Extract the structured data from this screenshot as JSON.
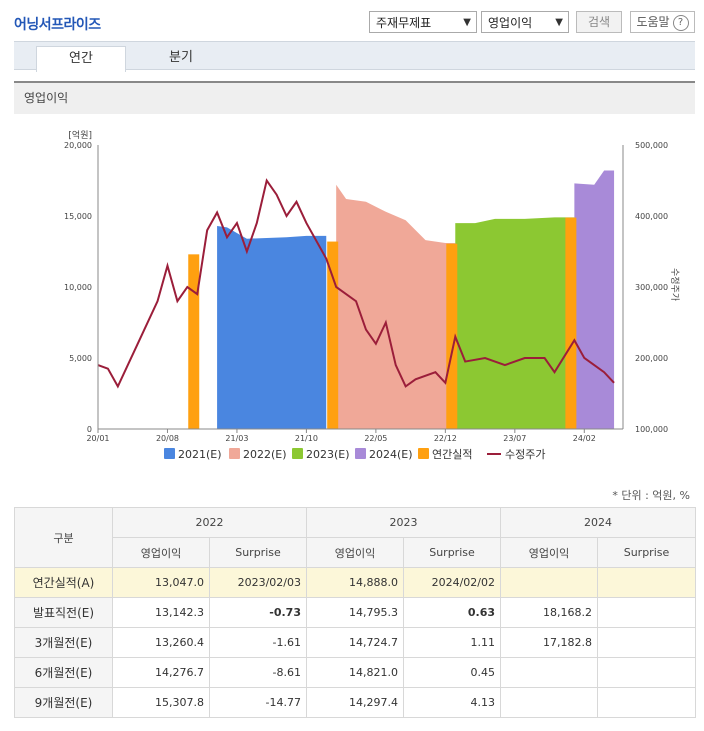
{
  "page": {
    "title": "어닝서프라이즈",
    "select_1": "주재무제표",
    "select_2": "영업이익",
    "search_button": "검색",
    "help_button": "도움말",
    "help_mark": "?",
    "tabs": [
      "연간",
      "분기"
    ],
    "section_title": "영업이익",
    "unit_note": "* 단위 : 억원, %"
  },
  "chart_data": {
    "type": "area",
    "left_axis_unit": "[억원]",
    "right_axis_label": "수정주가",
    "ylim_left": [
      0,
      20000
    ],
    "ylim_right": [
      100000,
      500000
    ],
    "left_ticks": [
      "20,000",
      "15,000",
      "10,000",
      "5,000",
      "0"
    ],
    "right_ticks": [
      "500,000",
      "400,000",
      "300,000",
      "200,000",
      "100,000"
    ],
    "x_ticks": [
      "20/01",
      "20/08",
      "21/03",
      "21/10",
      "22/05",
      "22/12",
      "23/07",
      "24/02"
    ],
    "grid": false,
    "legend_position": "bottom",
    "colors": {
      "2021(E)": "#4a86e0",
      "2022(E)": "#f0a898",
      "2023(E)": "#8cc832",
      "2024(E)": "#a88ad8",
      "연간실적": "#ffa010",
      "수정주가": "#9b1e3a"
    },
    "legend": [
      "2021(E)",
      "2022(E)",
      "2023(E)",
      "2024(E)",
      "연간실적",
      "수정주가"
    ],
    "series": [
      {
        "name": "2021(E)",
        "points": [
          [
            "21/01",
            14300
          ],
          [
            "21/02",
            14200
          ],
          [
            "21/04",
            13400
          ],
          [
            "21/06",
            13450
          ],
          [
            "21/08",
            13500
          ],
          [
            "21/10",
            13600
          ],
          [
            "21/12",
            13600
          ]
        ]
      },
      {
        "name": "2022(E)",
        "points": [
          [
            "22/01",
            17200
          ],
          [
            "22/02",
            16200
          ],
          [
            "22/04",
            16000
          ],
          [
            "22/06",
            15300
          ],
          [
            "22/08",
            14700
          ],
          [
            "22/10",
            13300
          ],
          [
            "22/12",
            13100
          ],
          [
            "23/01",
            13100
          ]
        ]
      },
      {
        "name": "2023(E)",
        "points": [
          [
            "23/01",
            14500
          ],
          [
            "23/03",
            14500
          ],
          [
            "23/05",
            14800
          ],
          [
            "23/08",
            14800
          ],
          [
            "23/11",
            14900
          ],
          [
            "24/01",
            14900
          ]
        ]
      },
      {
        "name": "2024(E)",
        "points": [
          [
            "24/01",
            17300
          ],
          [
            "24/03",
            17200
          ],
          [
            "24/04",
            18200
          ],
          [
            "24/05",
            18200
          ]
        ]
      },
      {
        "name": "연간실적",
        "points": [
          [
            "20/11",
            12300
          ],
          [
            "22/01",
            13200
          ],
          [
            "23/01",
            13047
          ],
          [
            "24/01",
            14888
          ]
        ]
      },
      {
        "name": "수정주가",
        "points": [
          [
            "20/01",
            190000
          ],
          [
            "20/02",
            185000
          ],
          [
            "20/03",
            160000
          ],
          [
            "20/05",
            220000
          ],
          [
            "20/07",
            280000
          ],
          [
            "20/08",
            330000
          ],
          [
            "20/09",
            280000
          ],
          [
            "20/10",
            300000
          ],
          [
            "20/11",
            290000
          ],
          [
            "20/12",
            380000
          ],
          [
            "21/01",
            405000
          ],
          [
            "21/02",
            370000
          ],
          [
            "21/03",
            390000
          ],
          [
            "21/04",
            350000
          ],
          [
            "21/05",
            390000
          ],
          [
            "21/06",
            450000
          ],
          [
            "21/07",
            430000
          ],
          [
            "21/08",
            400000
          ],
          [
            "21/09",
            420000
          ],
          [
            "21/10",
            390000
          ],
          [
            "21/12",
            340000
          ],
          [
            "22/01",
            300000
          ],
          [
            "22/03",
            280000
          ],
          [
            "22/04",
            240000
          ],
          [
            "22/05",
            220000
          ],
          [
            "22/06",
            250000
          ],
          [
            "22/07",
            190000
          ],
          [
            "22/08",
            160000
          ],
          [
            "22/09",
            170000
          ],
          [
            "22/11",
            180000
          ],
          [
            "22/12",
            165000
          ],
          [
            "23/01",
            230000
          ],
          [
            "23/02",
            195000
          ],
          [
            "23/04",
            200000
          ],
          [
            "23/06",
            190000
          ],
          [
            "23/08",
            200000
          ],
          [
            "23/10",
            200000
          ],
          [
            "23/11",
            180000
          ],
          [
            "24/01",
            225000
          ],
          [
            "24/02",
            200000
          ],
          [
            "24/03",
            190000
          ],
          [
            "24/04",
            180000
          ],
          [
            "24/05",
            165000
          ]
        ]
      }
    ]
  },
  "table": {
    "header_col": "구분",
    "years": [
      "2022",
      "2023",
      "2024"
    ],
    "subcols": [
      "영업이익",
      "Surprise"
    ],
    "rows": [
      {
        "label": "연간실적(A)",
        "cells": [
          "13,047.0",
          "2023/02/03",
          "14,888.0",
          "2024/02/02",
          "",
          ""
        ],
        "highlight": true
      },
      {
        "label": "발표직전(E)",
        "cells": [
          "13,142.3",
          "-0.73",
          "14,795.3",
          "0.63",
          "18,168.2",
          ""
        ]
      },
      {
        "label": "3개월전(E)",
        "cells": [
          "13,260.4",
          "-1.61",
          "14,724.7",
          "1.11",
          "17,182.8",
          ""
        ]
      },
      {
        "label": "6개월전(E)",
        "cells": [
          "14,276.7",
          "-8.61",
          "14,821.0",
          "0.45",
          "",
          ""
        ]
      },
      {
        "label": "9개월전(E)",
        "cells": [
          "15,307.8",
          "-14.77",
          "14,297.4",
          "4.13",
          "",
          ""
        ]
      }
    ]
  }
}
